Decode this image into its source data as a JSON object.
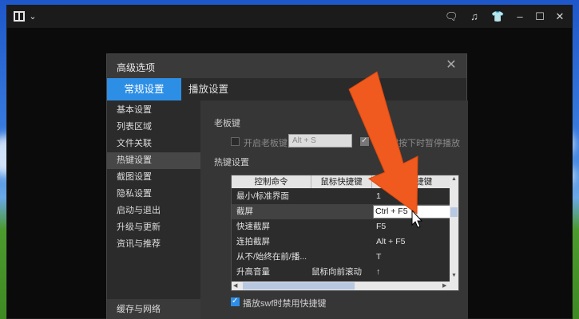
{
  "dialog": {
    "title": "高级选项",
    "close_icon": "close-icon"
  },
  "tabs": [
    {
      "label": "常规设置",
      "active": true
    },
    {
      "label": "播放设置",
      "active": false
    }
  ],
  "sidebar": {
    "items": [
      {
        "label": "基本设置"
      },
      {
        "label": "列表区域"
      },
      {
        "label": "文件关联"
      },
      {
        "label": "热键设置",
        "selected": true
      },
      {
        "label": "截图设置"
      },
      {
        "label": "隐私设置"
      },
      {
        "label": "启动与退出"
      },
      {
        "label": "升级与更新"
      },
      {
        "label": "资讯与推荐"
      }
    ],
    "bottom_item": "缓存与网络"
  },
  "boss_key": {
    "section_label": "老板键",
    "enable_label": "开启老板键",
    "enable_checked": false,
    "value": "Alt + S",
    "pause_label": "老板键按下时暂停播放",
    "pause_checked": true
  },
  "hotkeys": {
    "section_label": "热键设置",
    "columns": [
      "控制命令",
      "鼠标快捷键",
      "键盘快捷键"
    ],
    "rows": [
      {
        "command": "最小/标准界面",
        "mouse": "",
        "keyboard": "1"
      },
      {
        "command": "截屏",
        "mouse": "",
        "keyboard": "Ctrl + F5",
        "editing": true
      },
      {
        "command": "快速截屏",
        "mouse": "",
        "keyboard": "F5"
      },
      {
        "command": "连拍截屏",
        "mouse": "",
        "keyboard": "Alt + F5"
      },
      {
        "command": "从不/始终在前/播...",
        "mouse": "",
        "keyboard": "T"
      },
      {
        "command": "升高音量",
        "mouse": "鼠标向前滚动",
        "keyboard": "↑"
      }
    ],
    "disable_swf_label": "播放swf时禁用快捷键",
    "disable_swf_checked": true
  },
  "colors": {
    "accent": "#2d8ee6",
    "arrow": "#f05a1e"
  }
}
